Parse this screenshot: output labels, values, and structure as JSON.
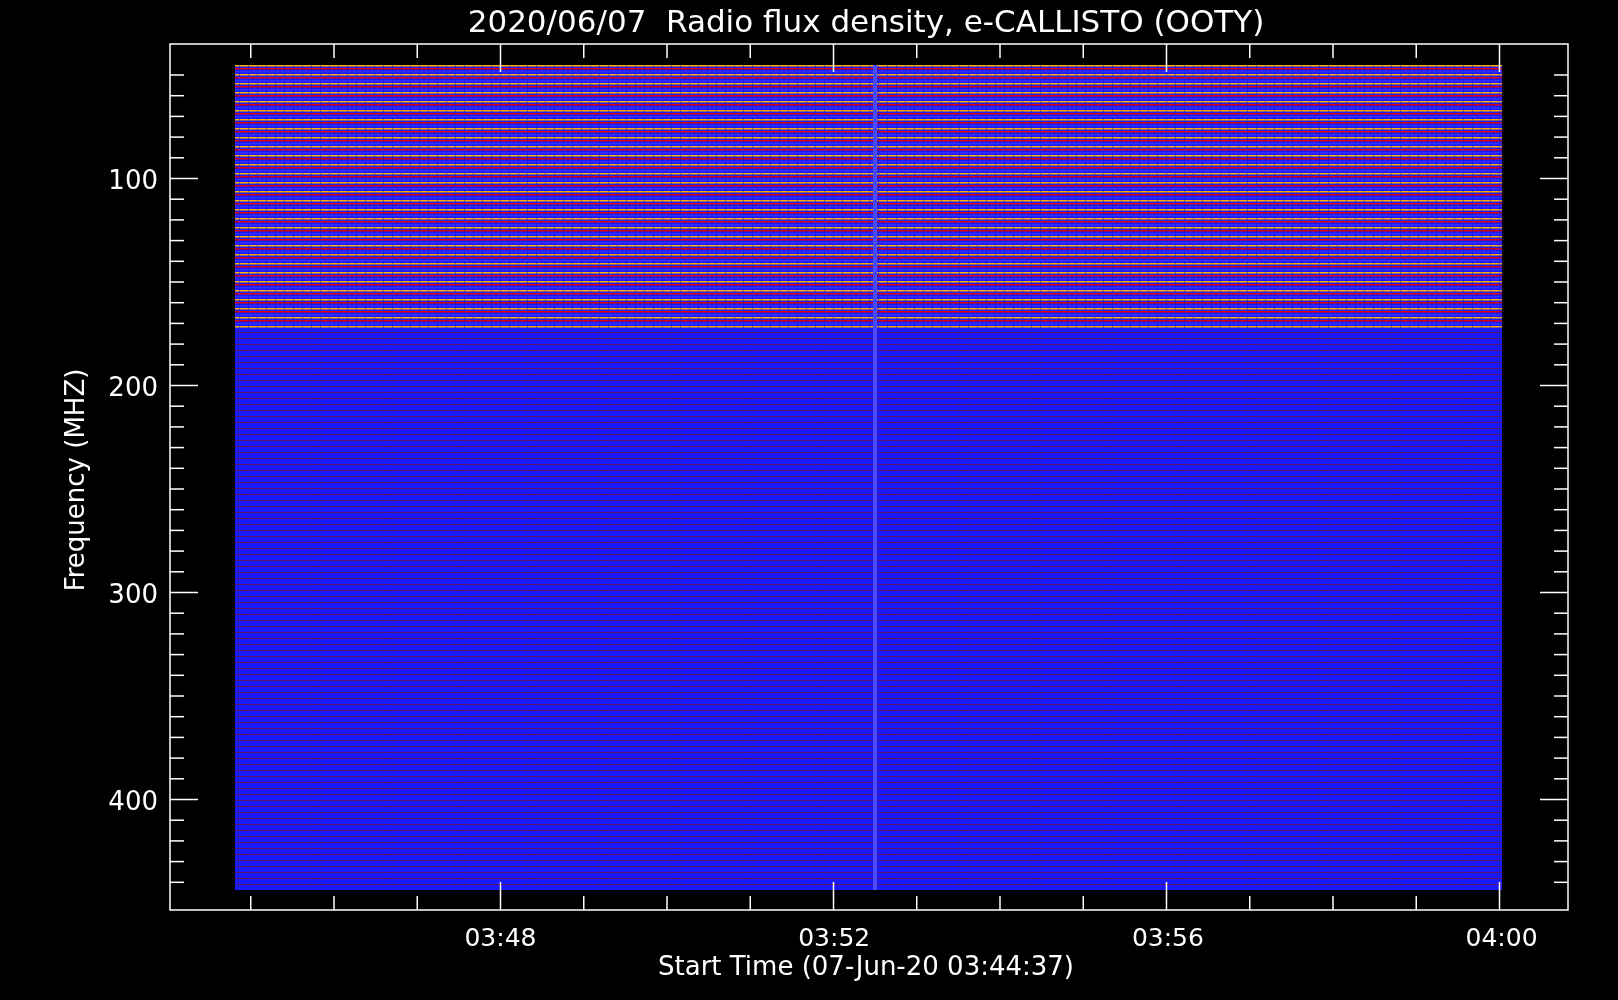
{
  "title": "2020/06/07  Radio flux density, e-CALLISTO (OOTY)",
  "y_axis": {
    "label": "Frequency (MHZ)",
    "ticks": [
      "100",
      "200",
      "300",
      "400"
    ]
  },
  "x_axis": {
    "label": "Start Time (07-Jun-20 03:44:37)",
    "ticks": [
      "03:48",
      "03:52",
      "03:56",
      "04:00"
    ]
  }
}
